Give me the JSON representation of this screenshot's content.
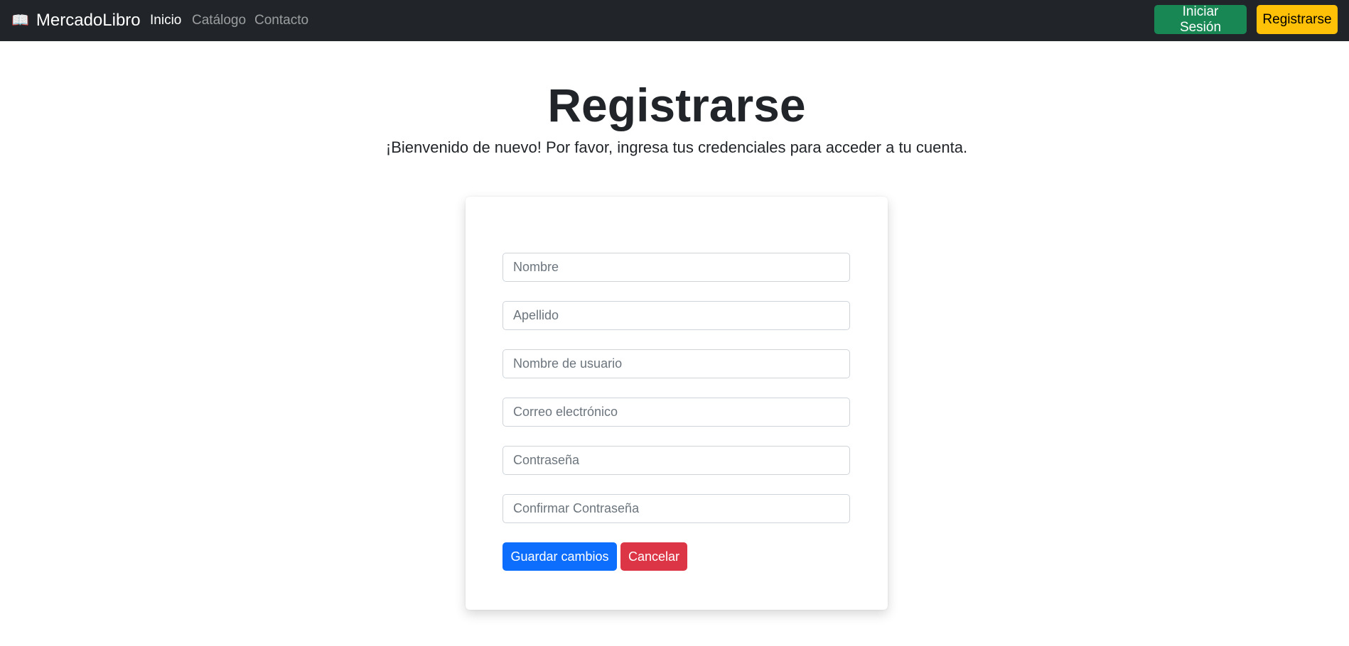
{
  "navbar": {
    "brand_icon": "open-book-icon",
    "brand_emoji": "📖",
    "brand": "MercadoLibro",
    "links": [
      {
        "label": "Inicio",
        "active": true
      },
      {
        "label": "Catálogo",
        "active": false
      },
      {
        "label": "Contacto",
        "active": false
      }
    ],
    "login_label": "Iniciar Sesión",
    "register_label": "Registrarse"
  },
  "page": {
    "title": "Registrarse",
    "subtitle": "¡Bienvenido de nuevo! Por favor, ingresa tus credenciales para acceder a tu cuenta."
  },
  "form": {
    "fields": [
      {
        "placeholder": "Nombre",
        "value": ""
      },
      {
        "placeholder": "Apellido",
        "value": ""
      },
      {
        "placeholder": "Nombre de usuario",
        "value": ""
      },
      {
        "placeholder": "Correo electrónico",
        "value": ""
      },
      {
        "placeholder": "Contraseña",
        "value": ""
      },
      {
        "placeholder": "Confirmar Contraseña",
        "value": ""
      }
    ],
    "save_label": "Guardar cambios",
    "cancel_label": "Cancelar"
  },
  "colors": {
    "navbar_bg": "#212529",
    "login_btn": "#198754",
    "register_btn": "#ffc107",
    "save_btn": "#0d6efd",
    "cancel_btn": "#dc3545"
  }
}
